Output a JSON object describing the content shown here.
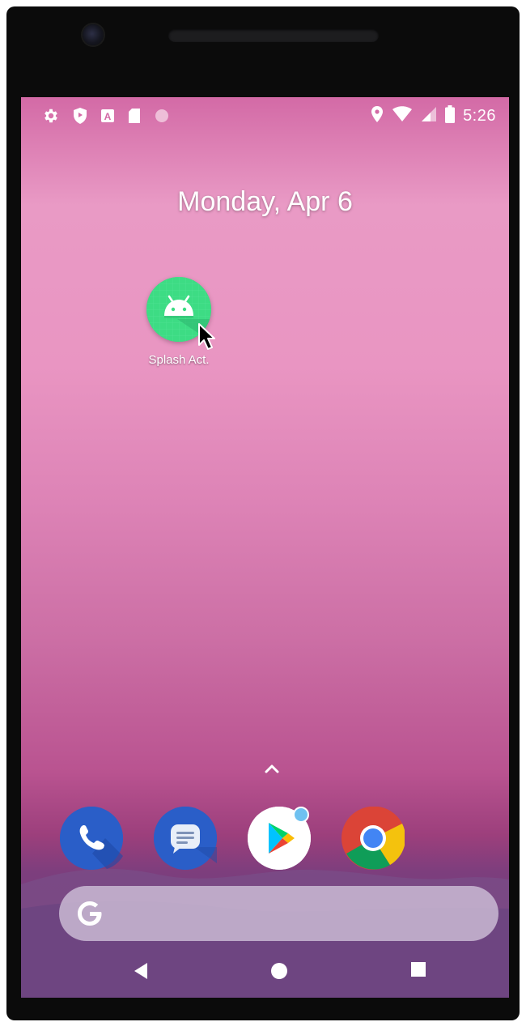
{
  "status_bar": {
    "time": "5:26",
    "left_icons": [
      "settings-icon",
      "shield-icon",
      "a-badge-icon",
      "sd-card-icon",
      "circle-notification-icon"
    ],
    "right_icons": [
      "location-pin-icon",
      "wifi-icon",
      "cell-signal-icon",
      "battery-icon"
    ]
  },
  "home": {
    "date": "Monday, Apr 6",
    "app_shortcut": {
      "label": "Splash Act.",
      "icon": "android-app-icon",
      "color": "#3ddc84"
    }
  },
  "dock": {
    "apps": [
      {
        "name": "Phone",
        "icon": "phone-icon",
        "color": "#2a5ec8"
      },
      {
        "name": "Messages",
        "icon": "messages-icon",
        "color": "#2a5ec8"
      },
      {
        "name": "Play Store",
        "icon": "play-store-icon",
        "color": "#ffffff"
      },
      {
        "name": "Chrome",
        "icon": "chrome-icon",
        "color": "#db4437"
      }
    ]
  },
  "search": {
    "icon": "google-g-icon"
  },
  "nav_bar": {
    "buttons": [
      "back-icon",
      "home-icon",
      "recents-icon"
    ]
  }
}
